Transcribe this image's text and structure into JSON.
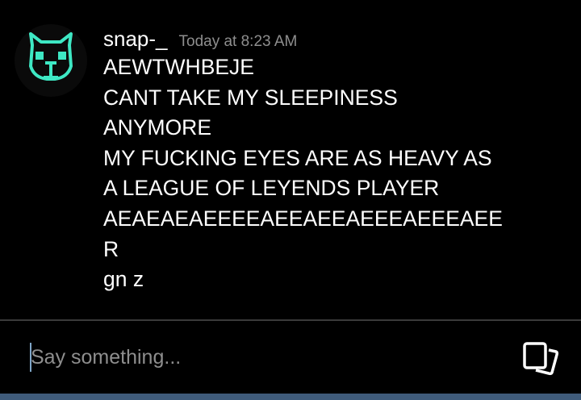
{
  "message": {
    "username": "snap-_",
    "timestamp": "Today at 8:23 AM",
    "lines": [
      "AEWTWHBEJE",
      "CANT TAKE MY SLEEPINESS",
      "ANYMORE",
      "MY FUCKING EYES ARE AS HEAVY AS",
      "A LEAGUE OF LEYENDS PLAYER",
      "AEAEAEAEEEEAEEAEEAEEEAEEEAEE",
      "R",
      "gn z"
    ],
    "avatar_icon": "cat-face-icon",
    "avatar_color": "#3ee8c4"
  },
  "composer": {
    "placeholder": "Say something...",
    "value": "",
    "action_icon": "gallery-icon"
  },
  "colors": {
    "background": "#000000",
    "text": "#ffffff",
    "muted": "#8e8e8e",
    "cursor": "#7fa6c8",
    "accent_strip": "#3f5b7a"
  }
}
